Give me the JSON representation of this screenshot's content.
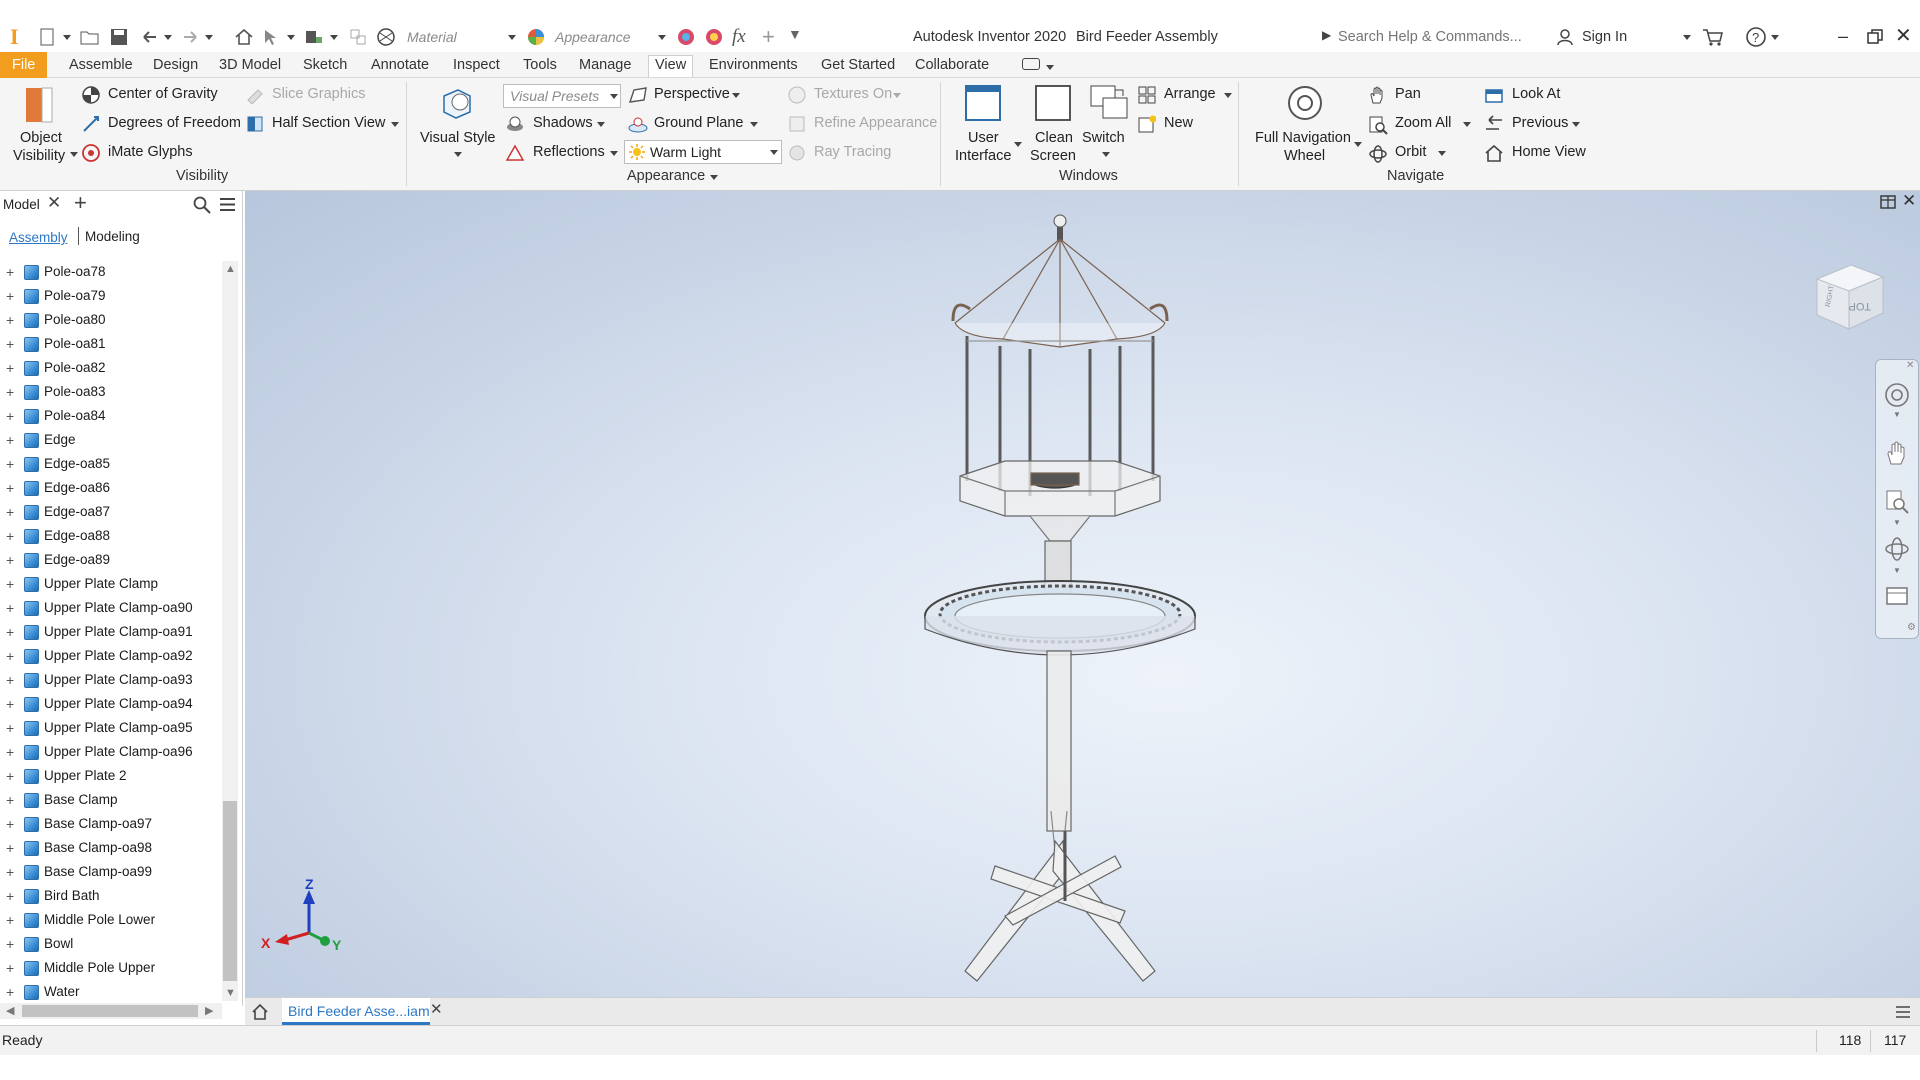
{
  "app": {
    "title": "Autodesk Inventor 2020",
    "document_title": "Bird Feeder Assembly",
    "search_placeholder": "Search Help & Commands...",
    "sign_in": "Sign In",
    "accent": "#f29d1d"
  },
  "quick_access": {
    "material": "Material",
    "appearance": "Appearance"
  },
  "tabs": [
    {
      "label": "File"
    },
    {
      "label": "Assemble"
    },
    {
      "label": "Design"
    },
    {
      "label": "3D Model"
    },
    {
      "label": "Sketch"
    },
    {
      "label": "Annotate"
    },
    {
      "label": "Inspect"
    },
    {
      "label": "Tools"
    },
    {
      "label": "Manage"
    },
    {
      "label": "View"
    },
    {
      "label": "Environments"
    },
    {
      "label": "Get Started"
    },
    {
      "label": "Collaborate"
    }
  ],
  "active_tab": "View",
  "ribbon": {
    "visibility": {
      "object_visibility_1": "Object",
      "object_visibility_2": "Visibility",
      "center_of_gravity": "Center of Gravity",
      "degrees_of_freedom": "Degrees of Freedom",
      "imate_glyphs": "iMate Glyphs",
      "slice_graphics": "Slice Graphics",
      "half_section_view": "Half Section View",
      "panel": "Visibility"
    },
    "appearance": {
      "visual_style": "Visual Style",
      "visual_presets": "Visual Presets",
      "shadows": "Shadows",
      "reflections": "Reflections",
      "perspective": "Perspective",
      "ground_plane": "Ground Plane",
      "lighting": "Warm Light",
      "textures_on": "Textures On",
      "refine_appearance": "Refine Appearance",
      "ray_tracing": "Ray Tracing",
      "panel": "Appearance"
    },
    "windows": {
      "user_interface_1": "User",
      "user_interface_2": "Interface",
      "clean_screen_1": "Clean",
      "clean_screen_2": "Screen",
      "switch": "Switch",
      "arrange": "Arrange",
      "new": "New",
      "panel": "Windows"
    },
    "navigate": {
      "full_nav_1": "Full Navigation",
      "full_nav_2": "Wheel",
      "pan": "Pan",
      "zoom_all": "Zoom All",
      "orbit": "Orbit",
      "look_at": "Look At",
      "previous": "Previous",
      "home_view": "Home View",
      "panel": "Navigate"
    }
  },
  "browser": {
    "title": "Model",
    "tab_assembly": "Assembly",
    "tab_modeling": "Modeling",
    "items": [
      "Pole-oa78",
      "Pole-oa79",
      "Pole-oa80",
      "Pole-oa81",
      "Pole-oa82",
      "Pole-oa83",
      "Pole-oa84",
      "Edge",
      "Edge-oa85",
      "Edge-oa86",
      "Edge-oa87",
      "Edge-oa88",
      "Edge-oa89",
      "Upper Plate Clamp",
      "Upper Plate Clamp-oa90",
      "Upper Plate Clamp-oa91",
      "Upper Plate Clamp-oa92",
      "Upper Plate Clamp-oa93",
      "Upper Plate Clamp-oa94",
      "Upper Plate Clamp-oa95",
      "Upper Plate Clamp-oa96",
      "Upper Plate 2",
      "Base Clamp",
      "Base Clamp-oa97",
      "Base Clamp-oa98",
      "Base Clamp-oa99",
      "Bird Bath",
      "Middle Pole Lower",
      "Bowl",
      "Middle Pole Upper",
      "Water"
    ]
  },
  "viewport": {
    "viewcube_top": "TOP",
    "viewcube_right": "RIGHT",
    "axis_x": "X",
    "axis_y": "Y",
    "axis_z": "Z"
  },
  "document_tab": "Bird Feeder Asse...iam",
  "status": {
    "text": "Ready",
    "count1": "118",
    "count2": "117"
  }
}
